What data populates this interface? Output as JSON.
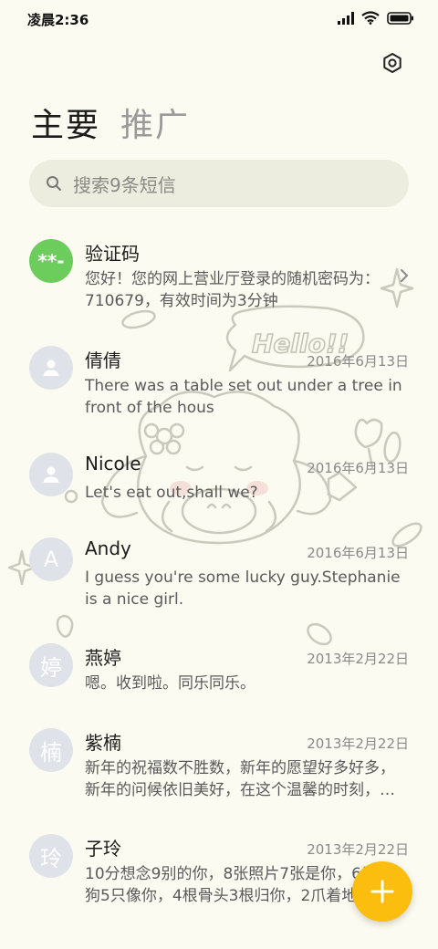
{
  "status_bar": {
    "time": "凌晨2:36"
  },
  "tabs": [
    {
      "label": "主要",
      "active": true
    },
    {
      "label": "推广",
      "active": false
    }
  ],
  "search": {
    "placeholder": "搜索9条短信"
  },
  "decoration": {
    "text": "Hello!!"
  },
  "conversations": [
    {
      "name": "验证码",
      "avatar_text": "**-",
      "avatar_color": "#6ccd5d",
      "date": "",
      "preview": "您好！您的网上营业厅登录的随机密码为：710679，有效时间为3分钟"
    },
    {
      "name": "倩倩",
      "avatar_text": "",
      "date": "2016年6月13日",
      "preview": "There was a table set out under a tree in front of the hous"
    },
    {
      "name": "Nicole",
      "avatar_text": "",
      "date": "2016年6月13日",
      "preview": "Let's eat out,shall we?"
    },
    {
      "name": "Andy",
      "avatar_text": "A",
      "date": "2016年6月13日",
      "preview": "I guess you're some lucky guy.Stephanie is a nice girl."
    },
    {
      "name": "燕婷",
      "avatar_text": "婷",
      "date": "2013年2月22日",
      "preview": "嗯。收到啦。同乐同乐。"
    },
    {
      "name": "紫楠",
      "avatar_text": "楠",
      "date": "2013年2月22日",
      "preview": "新年的祝福数不胜数，新年的愿望好多好多，新年的问候依旧美好，在这个温馨的时刻，…"
    },
    {
      "name": "子玲",
      "avatar_text": "玲",
      "date": "2013年2月22日",
      "preview": "10分想念9别的你，8张照片7张是你，6只小狗5只像你，4根骨头3根归你，2爪着地"
    }
  ],
  "icons": {
    "settings": "settings-gear-icon",
    "search": "search-icon",
    "fab": "plus-icon",
    "person": "person-icon",
    "chevron": "chevron-right-icon"
  },
  "colors": {
    "background": "#fbfbf1",
    "accent": "#fbbd0e",
    "verify_green": "#6ccd5d",
    "avatar_gray": "#dfe2e8"
  }
}
